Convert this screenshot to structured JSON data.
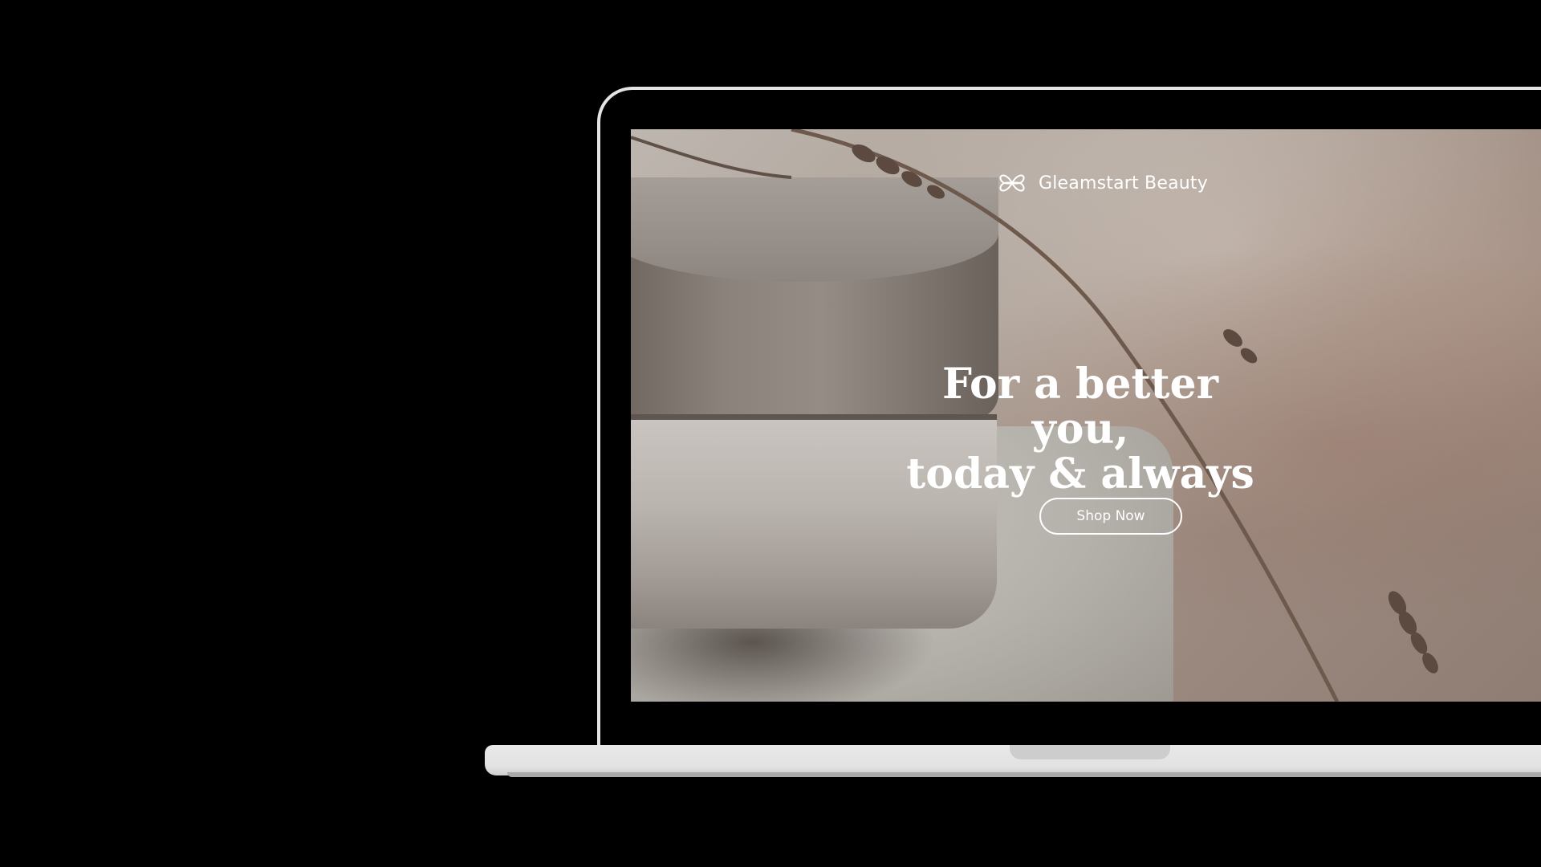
{
  "site": {
    "brand_name": "Gleamstart Beauty",
    "brand_icon": "clover-flower-icon"
  },
  "hero": {
    "title_line1": "For a better you,",
    "title_line2": "today & always",
    "cta_label": "Shop Now"
  },
  "colors": {
    "background": "#000000",
    "laptop_frame": "#e4e4e4",
    "text": "#ffffff"
  }
}
